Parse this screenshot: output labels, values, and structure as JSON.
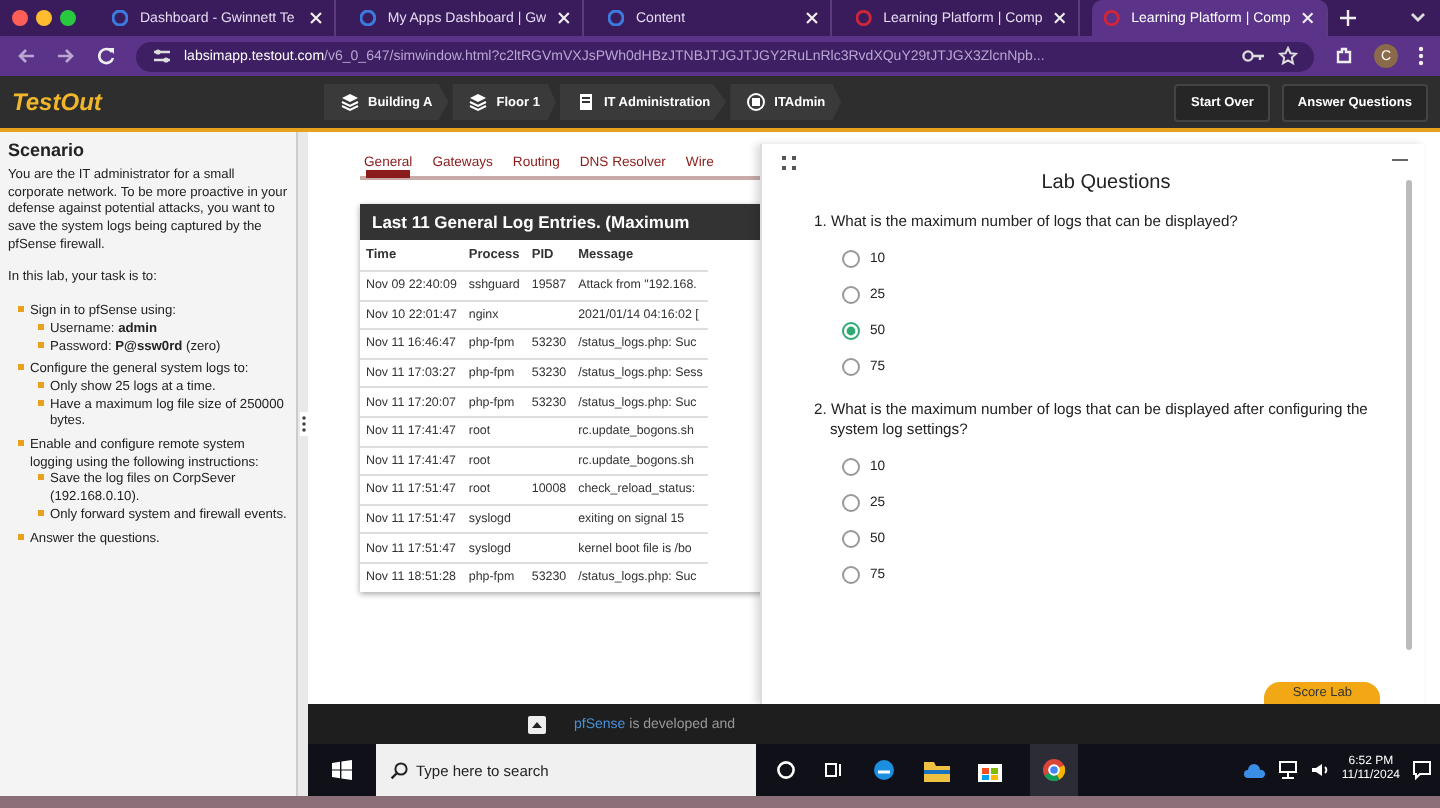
{
  "browser": {
    "tabs": [
      {
        "title": "Dashboard - Gwinnett Te",
        "selected": false
      },
      {
        "title": "My Apps Dashboard | Gw",
        "selected": false
      },
      {
        "title": "Content",
        "selected": false
      },
      {
        "title": "Learning Platform | Comp",
        "selected": false
      },
      {
        "title": "Learning Platform | Comp",
        "selected": true
      }
    ],
    "url_host": "labsimapp.testout.com",
    "url_path": "/v6_0_647/simwindow.html?c2ltRGVmVXJsPWh0dHBzJTNBJTJGJTJGY2RuLnRlc3RvdXQuY29tJTJGX3ZlcnNpb...",
    "profile": "C"
  },
  "header": {
    "logo": "TestOut",
    "breadcrumbs": [
      "Building A",
      "Floor 1",
      "IT Administration",
      "ITAdmin"
    ],
    "buttons": [
      "Start Over",
      "Answer Questions"
    ]
  },
  "scenario": {
    "title": "Scenario",
    "intro": "You are the IT administrator for a small corporate network. To be more proactive in your defense against potential attacks, you want to save the system logs being captured by the pfSense firewall.",
    "task": "In this lab, your task is to:",
    "items": [
      {
        "text": "Sign in to pfSense using:",
        "children": [
          {
            "text": "Username: **admin**"
          },
          {
            "text": "Password: **P@ssw0rd** (zero)"
          }
        ]
      },
      {
        "text": "Configure the general system logs to:",
        "children": [
          {
            "text": "Only show 25 logs at a time."
          },
          {
            "text": "Have a maximum log file size of 250000 bytes."
          }
        ]
      },
      {
        "text": "Enable and configure remote system logging using the following instructions:",
        "children": [
          {
            "text": "Save the log files on CorpSever (192.168.0.10)."
          },
          {
            "text": "Only forward system and firewall events."
          }
        ]
      },
      {
        "text": "Answer the questions."
      }
    ]
  },
  "pfsense": {
    "tabs": [
      {
        "label": "General",
        "selected": true
      },
      {
        "label": "Gateways",
        "selected": false
      },
      {
        "label": "Routing",
        "selected": false
      },
      {
        "label": "DNS Resolver",
        "selected": false
      },
      {
        "label": "Wire",
        "selected": false
      }
    ],
    "table": {
      "title": "Last 11 General Log Entries. (Maximum",
      "columns": [
        "Time",
        "Process",
        "PID",
        "Message"
      ],
      "rows": [
        [
          "Nov 09 22:40:09",
          "sshguard",
          "19587",
          "Attack from \"192.168."
        ],
        [
          "Nov 10 22:01:47",
          "nginx",
          "",
          "2021/01/14 04:16:02 ["
        ],
        [
          "Nov 11 16:46:47",
          "php-fpm",
          "53230",
          "/status_logs.php: Suc"
        ],
        [
          "Nov 11 17:03:27",
          "php-fpm",
          "53230",
          "/status_logs.php: Sess"
        ],
        [
          "Nov 11 17:20:07",
          "php-fpm",
          "53230",
          "/status_logs.php: Suc"
        ],
        [
          "Nov 11 17:41:47",
          "root",
          "",
          "rc.update_bogons.sh"
        ],
        [
          "Nov 11 17:41:47",
          "root",
          "",
          "rc.update_bogons.sh"
        ],
        [
          "Nov 11 17:51:47",
          "root",
          "10008",
          "check_reload_status:"
        ],
        [
          "Nov 11 17:51:47",
          "syslogd",
          "",
          "exiting on signal 15"
        ],
        [
          "Nov 11 17:51:47",
          "syslogd",
          "",
          "kernel boot file is /bo"
        ],
        [
          "Nov 11 18:51:28",
          "php-fpm",
          "53230",
          "/status_logs.php: Suc"
        ]
      ]
    },
    "footer_link": "pfSense",
    "footer_text": "is developed and"
  },
  "lab_questions": {
    "title": "Lab Questions",
    "questions": [
      {
        "text": "1. What is the maximum number of logs that can be displayed?",
        "options": [
          {
            "label": "10",
            "selected": false
          },
          {
            "label": "25",
            "selected": false
          },
          {
            "label": "50",
            "selected": true
          },
          {
            "label": "75",
            "selected": false
          }
        ]
      },
      {
        "text": "2. What is the maximum number of logs that can be displayed after configuring the system log settings?",
        "options": [
          {
            "label": "10",
            "selected": false
          },
          {
            "label": "25",
            "selected": false
          },
          {
            "label": "50",
            "selected": false
          },
          {
            "label": "75",
            "selected": false
          }
        ]
      }
    ],
    "button": "Score Lab"
  },
  "taskbar": {
    "search_placeholder": "Type here to search",
    "time": "6:52 PM",
    "date": "11/11/2024"
  }
}
